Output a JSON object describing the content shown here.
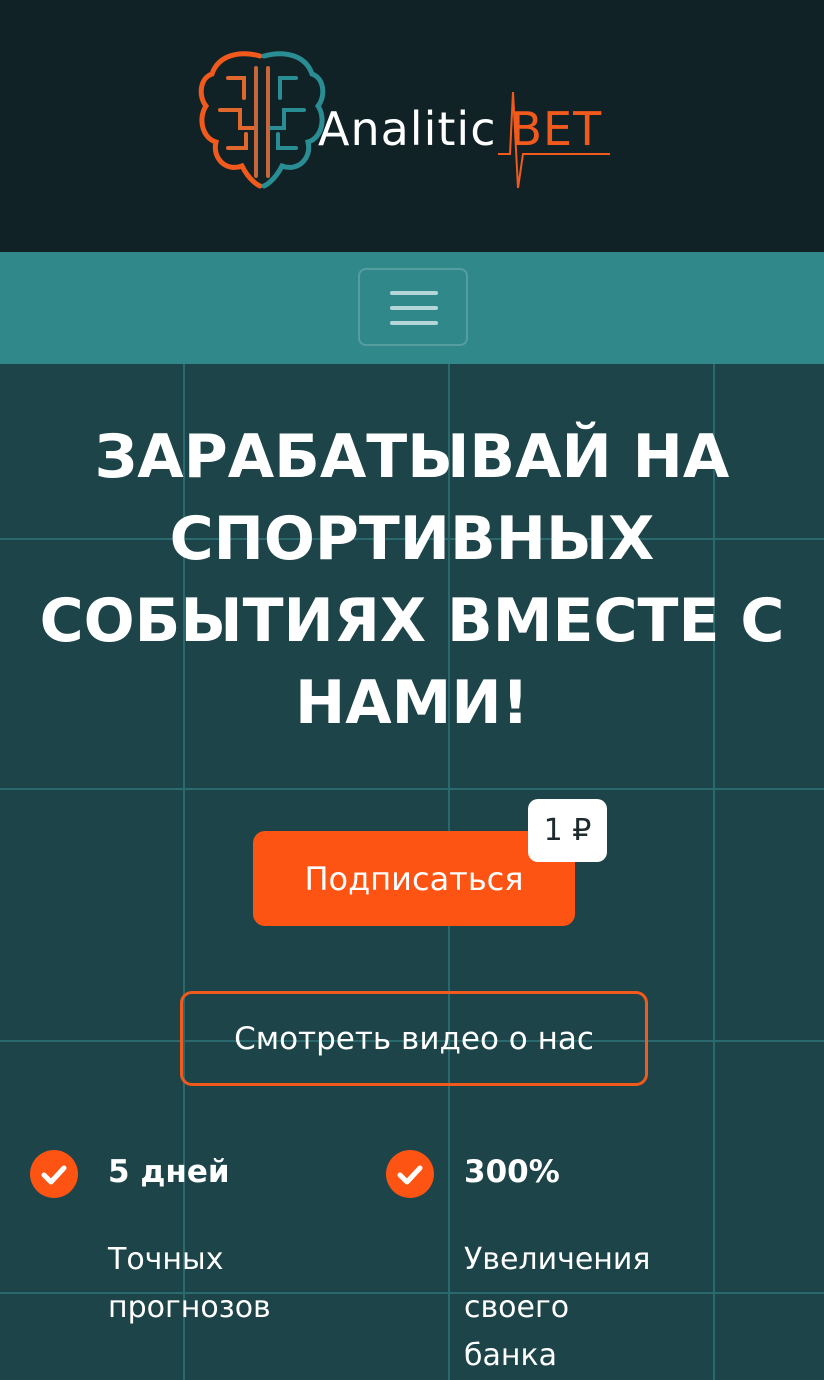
{
  "header": {
    "brand_name": "Analitic",
    "brand_accent": "BET",
    "logo_icon": "brain-circuit-icon"
  },
  "nav": {
    "menu_icon": "hamburger-menu-icon"
  },
  "hero": {
    "headline_lines": [
      "ЗАРАБАТЫВАЙ НА",
      "СПОРТИВНЫХ",
      "СОБЫТИЯХ ВМЕСТЕ С",
      "НАМИ!"
    ],
    "subscribe_label": "Подписаться",
    "price_badge": "1 ₽",
    "video_label": "Смотреть видео о нас"
  },
  "features": [
    {
      "value": "5 дней",
      "desc_lines": [
        "Точных",
        "прогнозов"
      ],
      "icon": "check-circle-icon"
    },
    {
      "value": "300%",
      "desc_lines": [
        "Увеличения своего",
        "банка"
      ],
      "icon": "check-circle-icon"
    }
  ],
  "colors": {
    "header_bg": "#112226",
    "nav_bg": "#31888b",
    "hero_bg": "#1d4449",
    "accent": "#fd5313",
    "brand_accent": "#f25a1d",
    "grid": "#2a6a6e"
  }
}
